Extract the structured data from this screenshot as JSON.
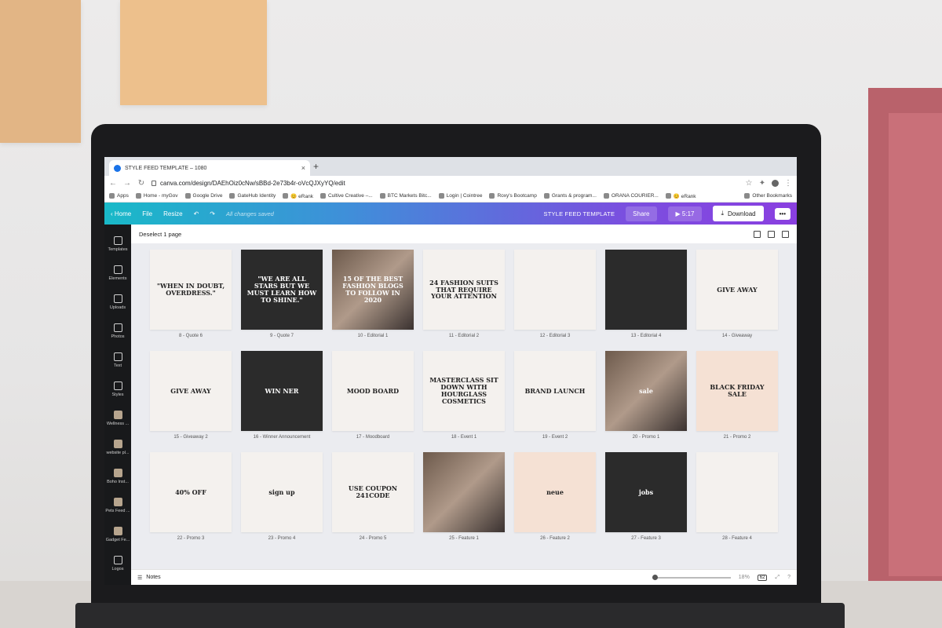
{
  "browser": {
    "tab_title": "STYLE FEED TEMPLATE – 1080",
    "tab_close": "×",
    "new_tab": "+",
    "url": "canva.com/design/DAEhOiz0cNw/sBBd-2e73b4r-oVcQJXyYQ/edit",
    "back_icon": "arrow-left-icon",
    "forward_icon": "arrow-right-icon",
    "reload_icon": "reload-icon",
    "bookmarks": [
      "Apps",
      "Home - myGov",
      "Google Drive",
      "GateHub Identity",
      "😊 eRank",
      "Cultive Creative –...",
      "BTC Markets Bitc...",
      "Login | Cointree",
      "Roxy's Bootcamp",
      "Grants & program...",
      "ORANA COURIER...",
      "😊 eRank"
    ],
    "other_bookmarks": "Other Bookmarks"
  },
  "canva_header": {
    "home": "Home",
    "file": "File",
    "resize": "Resize",
    "undo_icon": "undo-icon",
    "redo_icon": "redo-icon",
    "saved_status": "All changes saved",
    "design_title": "STYLE FEED TEMPLATE",
    "share": "Share",
    "present_time": "5:17",
    "download": "Download",
    "more": "•••",
    "accent_start": "#19b9c8",
    "accent_end": "#8a3fe0"
  },
  "sidebar": {
    "items": [
      "Templates",
      "Elements",
      "Uploads",
      "Photos",
      "Text",
      "Styles",
      "Wellness ...",
      "website pl...",
      "Boho Inst...",
      "Pets Feed ...",
      "Gadget Fe...",
      "Logos"
    ]
  },
  "toolbar": {
    "deselect": "Deselect 1 page"
  },
  "pages": [
    {
      "label": "8 - Quote 6",
      "text": "\"WHEN IN DOUBT, OVERDRESS.\""
    },
    {
      "label": "9 - Quote 7",
      "text": "\"WE ARE ALL STARS BUT WE MUST LEARN HOW TO SHINE.\""
    },
    {
      "label": "10 - Editorial 1",
      "text": "15 OF THE BEST FASHION BLOGS TO FOLLOW IN 2020"
    },
    {
      "label": "11 - Editorial 2",
      "text": "24 FASHION SUITS THAT REQUIRE YOUR ATTENTION"
    },
    {
      "label": "12 - Editorial 3",
      "text": ""
    },
    {
      "label": "13 - Editorial 4",
      "text": ""
    },
    {
      "label": "14 - Giveaway",
      "text": "GIVE AWAY"
    },
    {
      "label": "15 - Giveaway 2",
      "text": "GIVE AWAY"
    },
    {
      "label": "16 - Winner Announcement",
      "text": "WIN NER"
    },
    {
      "label": "17 - Moodboard",
      "text": "MOOD BOARD"
    },
    {
      "label": "18 - Event 1",
      "text": "MASTERCLASS SIT DOWN WITH HOURGLASS COSMETICS"
    },
    {
      "label": "19 - Event 2",
      "text": "BRAND LAUNCH"
    },
    {
      "label": "20 - Promo 1",
      "text": "sale"
    },
    {
      "label": "21 - Promo 2",
      "text": "BLACK FRIDAY SALE"
    },
    {
      "label": "22 - Promo 3",
      "text": "40% OFF"
    },
    {
      "label": "23 - Promo 4",
      "text": "sign up"
    },
    {
      "label": "24 - Promo 5",
      "text": "USE COUPON 241CODE"
    },
    {
      "label": "25 - Feature 1",
      "text": ""
    },
    {
      "label": "26 - Feature 2",
      "text": "neue"
    },
    {
      "label": "27 - Feature 3",
      "text": "jobs"
    },
    {
      "label": "28 - Feature 4",
      "text": ""
    }
  ],
  "bottombar": {
    "notes": "Notes",
    "zoom": "18%",
    "page_count": "62",
    "help": "?"
  }
}
